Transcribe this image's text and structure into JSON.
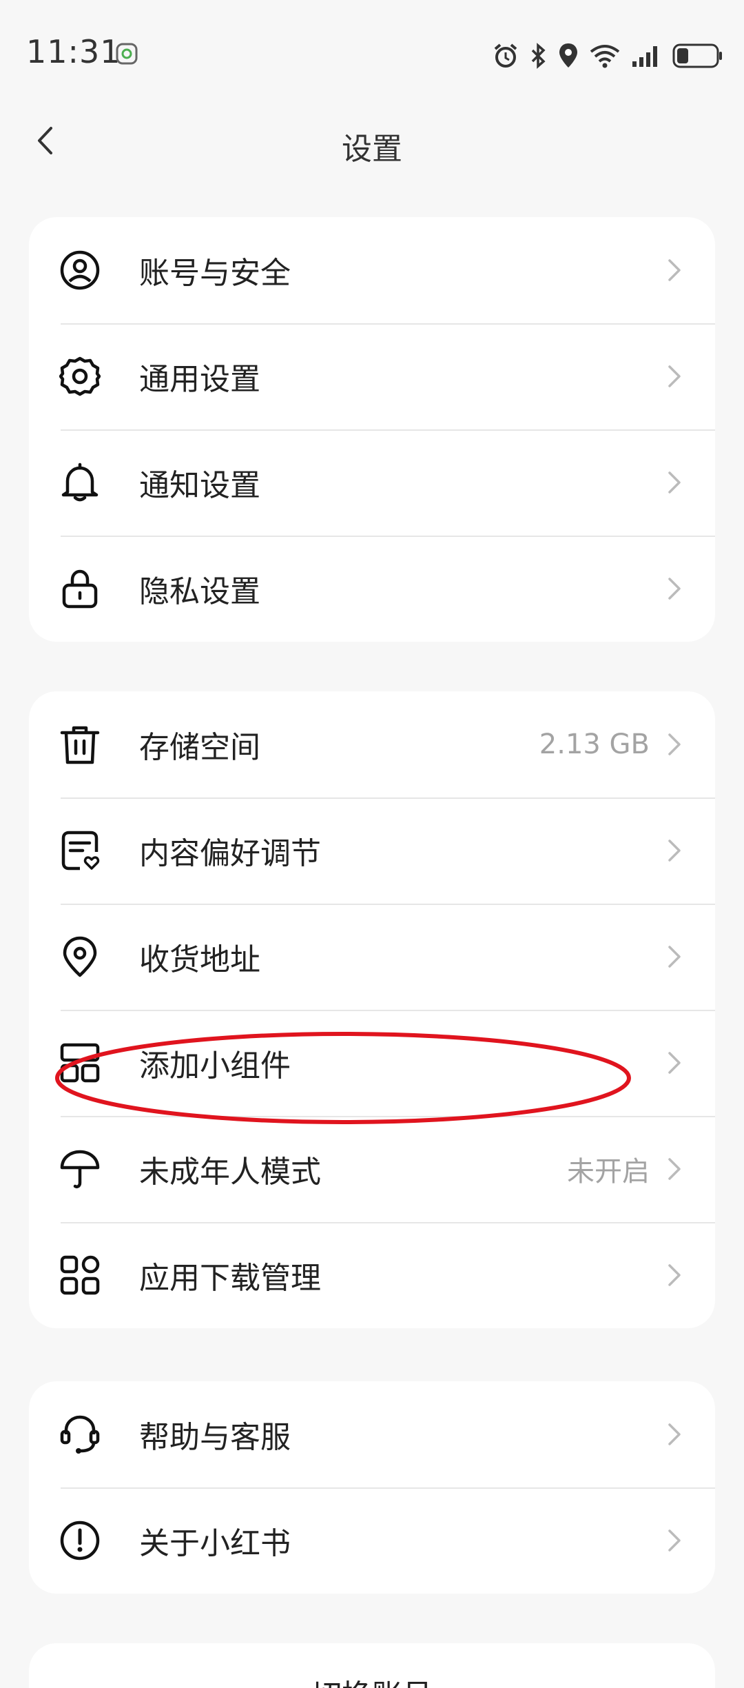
{
  "status_bar": {
    "time": "11:31"
  },
  "header": {
    "title": "设置",
    "back_icon": "chevron-left-icon"
  },
  "groups": [
    {
      "items": [
        {
          "label": "账号与安全",
          "icon": "user-circle-icon",
          "value": ""
        },
        {
          "label": "通用设置",
          "icon": "gear-icon",
          "value": ""
        },
        {
          "label": "通知设置",
          "icon": "bell-icon",
          "value": ""
        },
        {
          "label": "隐私设置",
          "icon": "lock-icon",
          "value": ""
        }
      ]
    },
    {
      "items": [
        {
          "label": "存储空间",
          "icon": "trash-icon",
          "value": "2.13 GB"
        },
        {
          "label": "内容偏好调节",
          "icon": "preference-icon",
          "value": ""
        },
        {
          "label": "收货地址",
          "icon": "location-pin-icon",
          "value": ""
        },
        {
          "label": "添加小组件",
          "icon": "widget-icon",
          "value": ""
        },
        {
          "label": "未成年人模式",
          "icon": "umbrella-icon",
          "value": "未开启"
        },
        {
          "label": "应用下载管理",
          "icon": "apps-grid-icon",
          "value": ""
        }
      ]
    },
    {
      "items": [
        {
          "label": "帮助与客服",
          "icon": "headset-icon",
          "value": ""
        },
        {
          "label": "关于小红书",
          "icon": "info-exclamation-icon",
          "value": ""
        }
      ]
    }
  ],
  "footer": {
    "switch_account": "切换账号"
  },
  "colors": {
    "background": "#f7f7f7",
    "card": "#ffffff",
    "annotation": "#e0141e",
    "secondary_text": "#a3a3a3"
  }
}
